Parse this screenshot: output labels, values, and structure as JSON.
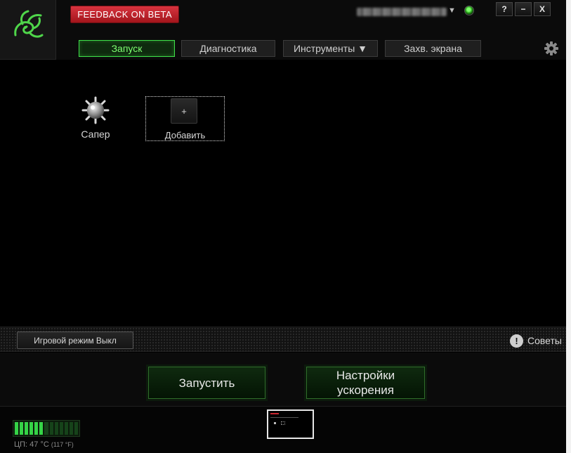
{
  "titlebar": {
    "feedback_label": "FEEDBACK ON BETA",
    "account_caret": "▼",
    "help_label": "?",
    "minimize_label": "−",
    "close_label": "X"
  },
  "tabs": [
    {
      "label": "Запуск",
      "active": true
    },
    {
      "label": "Диагностика",
      "active": false
    },
    {
      "label": "Инструменты ▼",
      "active": false
    },
    {
      "label": "Захв. экрана",
      "active": false
    }
  ],
  "games": [
    {
      "label": "Сапер",
      "icon": "minesweeper-icon"
    }
  ],
  "add_tile": {
    "plus": "+",
    "label": "Добавить"
  },
  "mode_bar": {
    "game_mode_label": "Игровой режим Выкл",
    "tips_icon": "!",
    "tips_label": "Советы"
  },
  "actions": {
    "launch_label": "Запустить",
    "boost_settings_label": "Настройки ускорения"
  },
  "status": {
    "cpu_label": "ЦП: 47 °C",
    "cpu_fahrenheit": "(117 °F)",
    "cpu_segments_on": 6,
    "cpu_segments_total": 13
  },
  "colors": {
    "accent_green": "#3fe14a",
    "feedback_red": "#c8262f",
    "background": "#000000"
  }
}
